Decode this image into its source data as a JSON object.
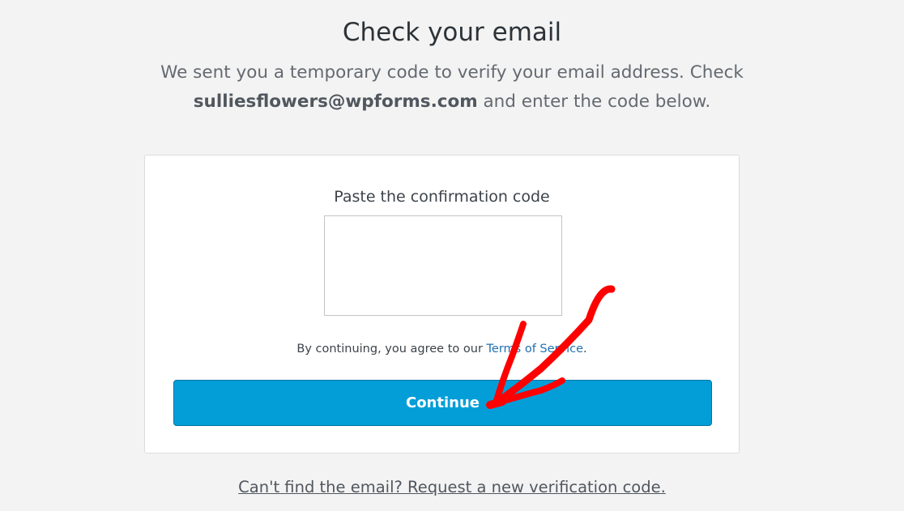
{
  "header": {
    "title": "Check your email",
    "subtitle_before": "We sent you a temporary code to verify your email address. Check",
    "email": "sulliesflowers@wpforms.com",
    "subtitle_after": " and enter the code below."
  },
  "form": {
    "code_label": "Paste the confirmation code",
    "code_value": "",
    "terms_prefix": "By continuing, you agree to our ",
    "terms_link": "Terms of Service",
    "terms_suffix": ".",
    "continue_label": "Continue"
  },
  "footer": {
    "resend_link": "Can't find the email? Request a new verification code."
  },
  "colors": {
    "button": "#039ed8",
    "link": "#2271b1",
    "annotation_arrow": "#ff0000"
  },
  "icons": {
    "annotation": "red-arrow-annotation"
  }
}
